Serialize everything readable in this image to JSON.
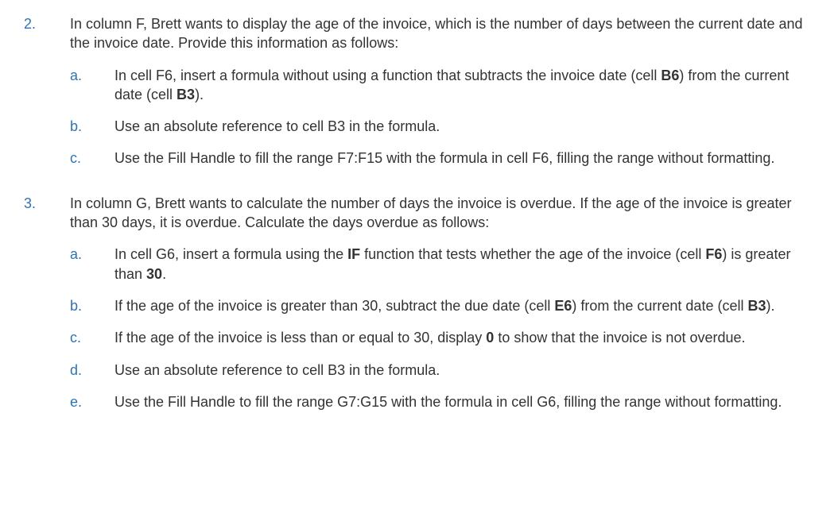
{
  "items": [
    {
      "number": "2.",
      "intro_parts": [
        {
          "text": "In column F, Brett wants to display the age of the invoice, which is the number of days between the current date and the invoice date. Provide this information as follows:",
          "bold": false
        }
      ],
      "subs": [
        {
          "marker": "a.",
          "parts": [
            {
              "text": "In cell F6, insert a formula without using a function that subtracts the invoice date (cell ",
              "bold": false
            },
            {
              "text": "B6",
              "bold": true
            },
            {
              "text": ") from the current date (cell ",
              "bold": false
            },
            {
              "text": "B3",
              "bold": true
            },
            {
              "text": ").",
              "bold": false
            }
          ]
        },
        {
          "marker": "b.",
          "parts": [
            {
              "text": "Use an absolute reference to cell B3 in the formula.",
              "bold": false
            }
          ]
        },
        {
          "marker": "c.",
          "parts": [
            {
              "text": "Use the Fill Handle to fill the range F7:F15 with the formula in cell F6, filling the range without formatting.",
              "bold": false
            }
          ]
        }
      ]
    },
    {
      "number": "3.",
      "intro_parts": [
        {
          "text": "In column G, Brett wants to calculate the number of days the invoice is overdue. If the age of the invoice is greater than 30 days, it is overdue. Calculate the days overdue as follows:",
          "bold": false
        }
      ],
      "subs": [
        {
          "marker": "a.",
          "parts": [
            {
              "text": "In cell G6, insert a formula using the ",
              "bold": false
            },
            {
              "text": "IF",
              "bold": true
            },
            {
              "text": " function that tests whether the age of the invoice (cell ",
              "bold": false
            },
            {
              "text": "F6",
              "bold": true
            },
            {
              "text": ") is greater than ",
              "bold": false
            },
            {
              "text": "30",
              "bold": true
            },
            {
              "text": ".",
              "bold": false
            }
          ]
        },
        {
          "marker": "b.",
          "parts": [
            {
              "text": "If the age of the invoice is greater than 30, subtract the due date (cell ",
              "bold": false
            },
            {
              "text": "E6",
              "bold": true
            },
            {
              "text": ") from the current date (cell ",
              "bold": false
            },
            {
              "text": "B3",
              "bold": true
            },
            {
              "text": ").",
              "bold": false
            }
          ]
        },
        {
          "marker": "c.",
          "parts": [
            {
              "text": "If the age of the invoice is less than or equal to 30, display ",
              "bold": false
            },
            {
              "text": "0",
              "bold": true
            },
            {
              "text": " to show that the invoice is not overdue.",
              "bold": false
            }
          ]
        },
        {
          "marker": "d.",
          "parts": [
            {
              "text": "Use an absolute reference to cell B3 in the formula.",
              "bold": false
            }
          ]
        },
        {
          "marker": "e.",
          "parts": [
            {
              "text": "Use the Fill Handle to fill the range G7:G15 with the formula in cell G6, filling the range without formatting.",
              "bold": false
            }
          ]
        }
      ]
    }
  ]
}
